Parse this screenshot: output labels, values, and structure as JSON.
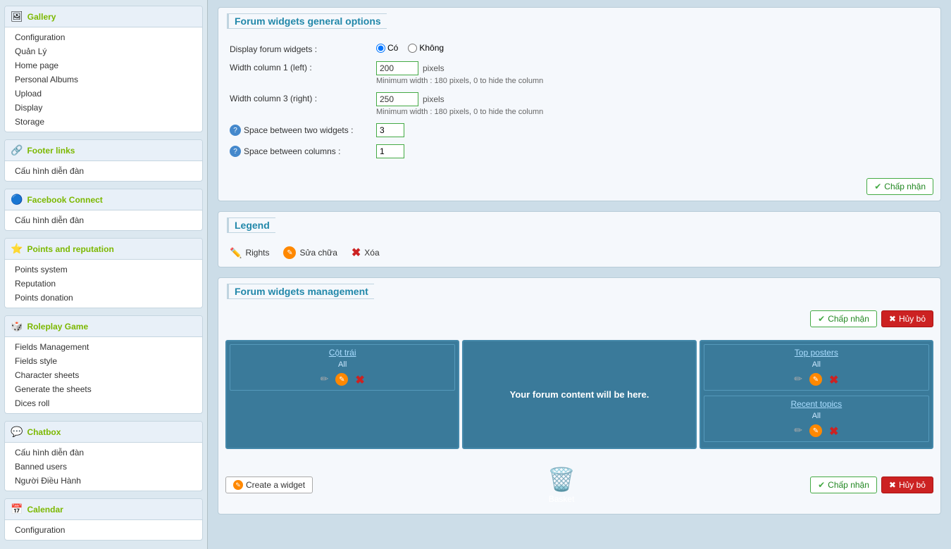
{
  "sidebar": {
    "sections": [
      {
        "id": "gallery",
        "title": "Gallery",
        "icon": "🖼",
        "items": [
          {
            "label": "Configuration",
            "href": "#"
          },
          {
            "label": "Quản Lý",
            "href": "#"
          },
          {
            "label": "Home page",
            "href": "#"
          },
          {
            "label": "Personal Albums",
            "href": "#"
          },
          {
            "label": "Upload",
            "href": "#"
          },
          {
            "label": "Display",
            "href": "#"
          },
          {
            "label": "Storage",
            "href": "#"
          }
        ]
      },
      {
        "id": "footer-links",
        "title": "Footer links",
        "icon": "🔗",
        "items": [
          {
            "label": "Cấu hình diễn đàn",
            "href": "#"
          }
        ]
      },
      {
        "id": "facebook-connect",
        "title": "Facebook Connect",
        "icon": "f",
        "items": [
          {
            "label": "Cấu hình diễn đàn",
            "href": "#"
          }
        ]
      },
      {
        "id": "points-reputation",
        "title": "Points and reputation",
        "icon": "⭐",
        "items": [
          {
            "label": "Points system",
            "href": "#"
          },
          {
            "label": "Reputation",
            "href": "#"
          },
          {
            "label": "Points donation",
            "href": "#"
          }
        ]
      },
      {
        "id": "roleplay-game",
        "title": "Roleplay Game",
        "icon": "🎲",
        "items": [
          {
            "label": "Fields Management",
            "href": "#"
          },
          {
            "label": "Fields style",
            "href": "#"
          },
          {
            "label": "Character sheets",
            "href": "#"
          },
          {
            "label": "Generate the sheets",
            "href": "#"
          },
          {
            "label": "Dices roll",
            "href": "#"
          }
        ]
      },
      {
        "id": "chatbox",
        "title": "Chatbox",
        "icon": "💬",
        "items": [
          {
            "label": "Cấu hình diễn đàn",
            "href": "#"
          },
          {
            "label": "Banned users",
            "href": "#"
          },
          {
            "label": "Người Điều Hành",
            "href": "#"
          }
        ]
      },
      {
        "id": "calendar",
        "title": "Calendar",
        "icon": "📅",
        "items": [
          {
            "label": "Configuration",
            "href": "#"
          }
        ]
      }
    ]
  },
  "main": {
    "general_options": {
      "title": "Forum widgets general options",
      "display_label": "Display forum widgets :",
      "display_yes": "Có",
      "display_no": "Không",
      "col1_label": "Width column 1 (left) :",
      "col1_value": "200",
      "col3_label": "Width column 3 (right) :",
      "col3_value": "250",
      "pixels_text": "pixels",
      "min_width_hint": "Minimum width : 180 pixels, 0 to hide the column",
      "space_widgets_label": "Space between two widgets :",
      "space_widgets_value": "3",
      "space_cols_label": "Space between columns :",
      "space_cols_value": "1",
      "accept_btn": "Chấp nhận"
    },
    "legend": {
      "title": "Legend",
      "items": [
        {
          "icon": "rights",
          "label": "Rights"
        },
        {
          "icon": "edit",
          "label": "Sửa chữa"
        },
        {
          "icon": "delete",
          "label": "Xóa"
        }
      ]
    },
    "widget_management": {
      "title": "Forum widgets management",
      "accept_btn": "Chấp nhận",
      "cancel_btn": "Hủy bỏ",
      "left_col_title": "Cột trái",
      "left_col_subtitle": "All",
      "center_placeholder": "Your forum content will be here.",
      "right_widgets": [
        {
          "title": "Top posters",
          "subtitle": "All"
        },
        {
          "title": "Recent topics",
          "subtitle": "All"
        }
      ],
      "create_widget_btn": "Create a widget",
      "basket_label": "Basket",
      "accept_btn2": "Chấp nhận",
      "cancel_btn2": "Hủy bỏ"
    }
  }
}
